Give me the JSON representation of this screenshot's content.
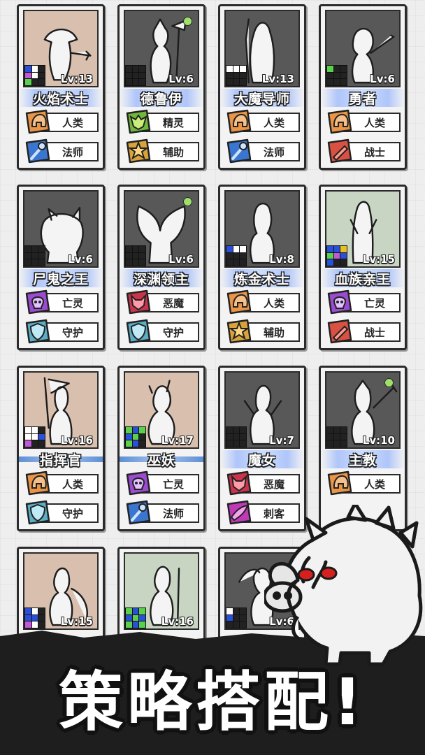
{
  "cards": [
    {
      "name": "火焰术士",
      "level": "Lv:13",
      "bg": "tan",
      "dot": false,
      "bar": "sparkle",
      "race": "人类",
      "race_icon": "human-helmet-icon",
      "role": "法师",
      "role_icon": "mage-staff-icon",
      "grid": [
        "#2a4fd8",
        "#ffffff",
        "#222",
        "#c158d6",
        "#ffffff",
        "#222",
        "#5ad14b",
        "#222",
        "#222"
      ]
    },
    {
      "name": "德鲁伊",
      "level": "Lv:6",
      "bg": "dark",
      "dot": true,
      "bar": "sparkle",
      "race": "精灵",
      "race_icon": "elf-mask-icon",
      "role": "辅助",
      "role_icon": "support-star-icon",
      "grid": [
        "#222",
        "#222",
        "#222",
        "#222",
        "#222",
        "#222",
        "#222",
        "#222",
        "#222"
      ]
    },
    {
      "name": "大魔导师",
      "level": "Lv:13",
      "bg": "dark",
      "dot": false,
      "bar": "sparkle",
      "race": "人类",
      "race_icon": "human-helmet-icon",
      "role": "法师",
      "role_icon": "mage-staff-icon",
      "grid": [
        "#ffffff",
        "#ffffff",
        "#ffffff",
        "#222",
        "#222",
        "#222",
        "#222",
        "#222",
        "#222"
      ]
    },
    {
      "name": "勇者",
      "level": "Lv:6",
      "bg": "dark",
      "dot": false,
      "bar": "sparkle",
      "race": "人类",
      "race_icon": "human-helmet-icon",
      "role": "战士",
      "role_icon": "warrior-sword-icon",
      "grid": [
        "#5ad14b",
        "#222",
        "#222",
        "#222",
        "#222",
        "#222",
        "#222",
        "#222",
        "#222"
      ]
    },
    {
      "name": "尸鬼之王",
      "level": "Lv:6",
      "bg": "dark",
      "dot": false,
      "bar": "sparkle",
      "race": "亡灵",
      "race_icon": "undead-skull-icon",
      "role": "守护",
      "role_icon": "guard-shield-icon",
      "grid": [
        "#222",
        "#222",
        "#222",
        "#222",
        "#222",
        "#222",
        "#222",
        "#222",
        "#222"
      ]
    },
    {
      "name": "深渊领主",
      "level": "Lv:6",
      "bg": "dark",
      "dot": true,
      "bar": "sparkle",
      "race": "恶魔",
      "race_icon": "demon-face-icon",
      "role": "守护",
      "role_icon": "guard-shield-icon",
      "grid": [
        "#222",
        "#222",
        "#222",
        "#222",
        "#222",
        "#222",
        "#222",
        "#222",
        "#222"
      ]
    },
    {
      "name": "炼金术士",
      "level": "Lv:8",
      "bg": "dark",
      "dot": false,
      "bar": "sparkle",
      "race": "人类",
      "race_icon": "human-helmet-icon",
      "role": "辅助",
      "role_icon": "support-star-icon",
      "grid": [
        "#2a4fd8",
        "#ffffff",
        "#ffffff",
        "#222",
        "#222",
        "#222",
        "#222",
        "#222",
        "#222"
      ]
    },
    {
      "name": "血族亲王",
      "level": "Lv:15",
      "bg": "green",
      "dot": false,
      "bar": "sparkle",
      "race": "亡灵",
      "race_icon": "undead-skull-icon",
      "role": "战士",
      "role_icon": "warrior-sword-icon",
      "grid": [
        "#2a4fd8",
        "#2a4fd8",
        "#e8c020",
        "#5ad14b",
        "#c158d6",
        "#2a4fd8",
        "#2a4fd8",
        "#222",
        "#222"
      ]
    },
    {
      "name": "指挥官",
      "level": "Lv:16",
      "bg": "tan",
      "dot": false,
      "bar": "plain",
      "race": "人类",
      "race_icon": "human-helmet-icon",
      "role": "守护",
      "role_icon": "guard-shield-icon",
      "grid": [
        "#ffffff",
        "#ffffff",
        "#222",
        "#ffffff",
        "#ffffff",
        "#2a4fd8",
        "#c158d6",
        "#222",
        "#222"
      ]
    },
    {
      "name": "巫妖",
      "level": "Lv:17",
      "bg": "tan",
      "dot": false,
      "bar": "plain",
      "race": "亡灵",
      "race_icon": "undead-skull-icon",
      "role": "法师",
      "role_icon": "mage-staff-icon",
      "grid": [
        "#5ad14b",
        "#2a4fd8",
        "#5ad14b",
        "#2a4fd8",
        "#5ad14b",
        "#222",
        "#5ad14b",
        "#2a4fd8",
        "#222"
      ]
    },
    {
      "name": "魔女",
      "level": "Lv:7",
      "bg": "dark",
      "dot": false,
      "bar": "sparkle",
      "race": "恶魔",
      "race_icon": "demon-face-icon",
      "role": "刺客",
      "role_icon": "assassin-blade-icon",
      "grid": [
        "#222",
        "#222",
        "#222",
        "#222",
        "#222",
        "#222",
        "#222",
        "#222",
        "#222"
      ]
    },
    {
      "name": "主教",
      "level": "Lv:10",
      "bg": "dark",
      "dot": true,
      "bar": "sparkle",
      "race": "人类",
      "race_icon": "human-helmet-icon",
      "role": "",
      "role_icon": "",
      "grid": [
        "#222",
        "#222",
        "#222",
        "#222",
        "#222",
        "#222",
        "#222",
        "#222",
        "#222"
      ]
    },
    {
      "name": "",
      "level": "Lv:15",
      "bg": "tan",
      "dot": false,
      "bar": "none",
      "race": "",
      "race_icon": "",
      "role": "",
      "role_icon": "",
      "grid": [
        "#2a4fd8",
        "#ffffff",
        "#222",
        "#2a4fd8",
        "#2a4fd8",
        "#222",
        "#c158d6",
        "#ffffff",
        "#222"
      ]
    },
    {
      "name": "",
      "level": "Lv:16",
      "bg": "green",
      "dot": false,
      "bar": "none",
      "race": "",
      "race_icon": "",
      "role": "",
      "role_icon": "",
      "grid": [
        "#5ad14b",
        "#2a4fd8",
        "#5ad14b",
        "#2a4fd8",
        "#5ad14b",
        "#2a4fd8",
        "#5ad14b",
        "#2a4fd8",
        "#5ad14b"
      ]
    },
    {
      "name": "",
      "level": "Lv:6",
      "bg": "dark",
      "dot": false,
      "bar": "none",
      "race": "",
      "race_icon": "",
      "role": "",
      "role_icon": "",
      "grid": [
        "#ffffff",
        "#222",
        "#222",
        "#2a4fd8",
        "#222",
        "#222",
        "#222",
        "#222",
        "#222"
      ]
    }
  ],
  "banner": {
    "text": "策略搭配!"
  },
  "mascot": {
    "icon": "boar-mascot-icon"
  }
}
